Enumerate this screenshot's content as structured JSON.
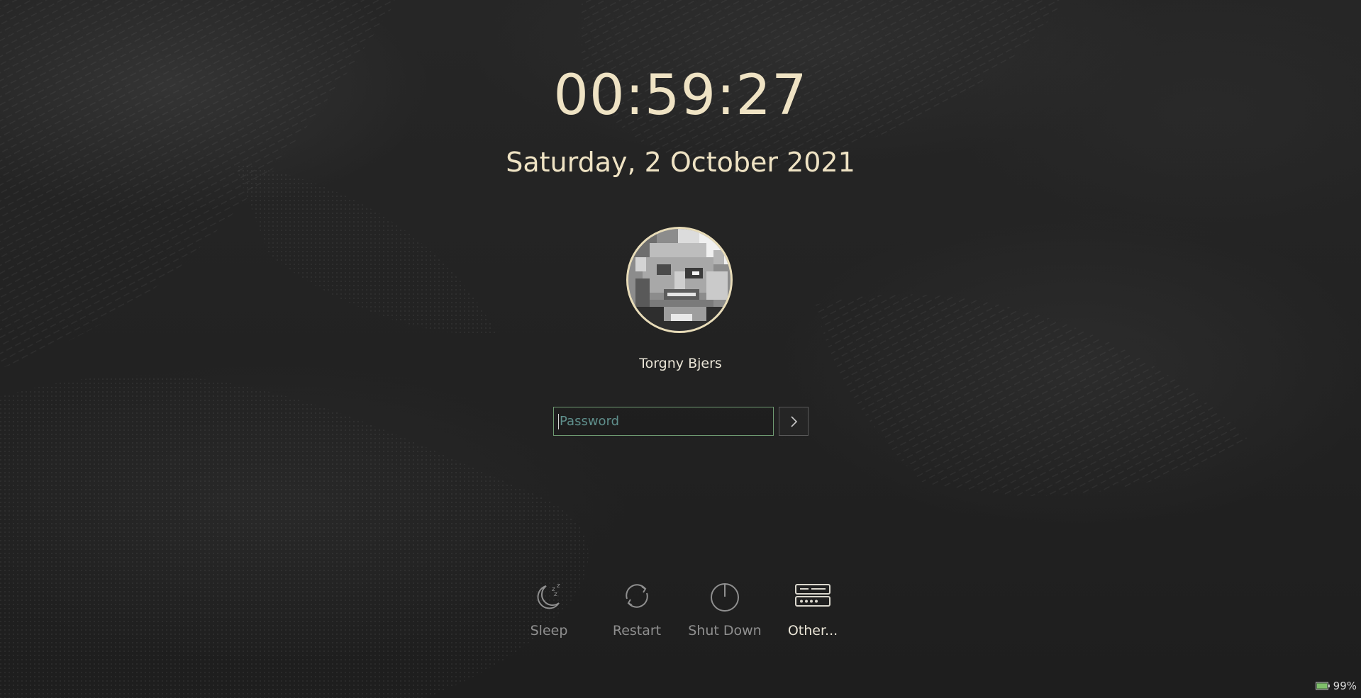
{
  "lockscreen": {
    "time": "00:59:27",
    "date": "Saturday, 2 October 2021",
    "colors": {
      "accent_text": "#efe3c4",
      "field_border": "#6f9a72",
      "placeholder": "#5f8f8c"
    }
  },
  "user": {
    "name": "Torgny Bjers",
    "avatar_icon": "user-avatar-photo"
  },
  "login": {
    "password_placeholder": "Password",
    "password_value": "",
    "submit_icon": "chevron-right-icon"
  },
  "actions": [
    {
      "label": "Sleep",
      "icon": "sleep-moon-icon"
    },
    {
      "label": "Restart",
      "icon": "restart-icon"
    },
    {
      "label": "Shut Down",
      "icon": "power-icon"
    },
    {
      "label": "Other...",
      "icon": "switch-user-icon"
    }
  ],
  "status": {
    "battery_percent": "99%",
    "battery_icon": "battery-icon"
  }
}
